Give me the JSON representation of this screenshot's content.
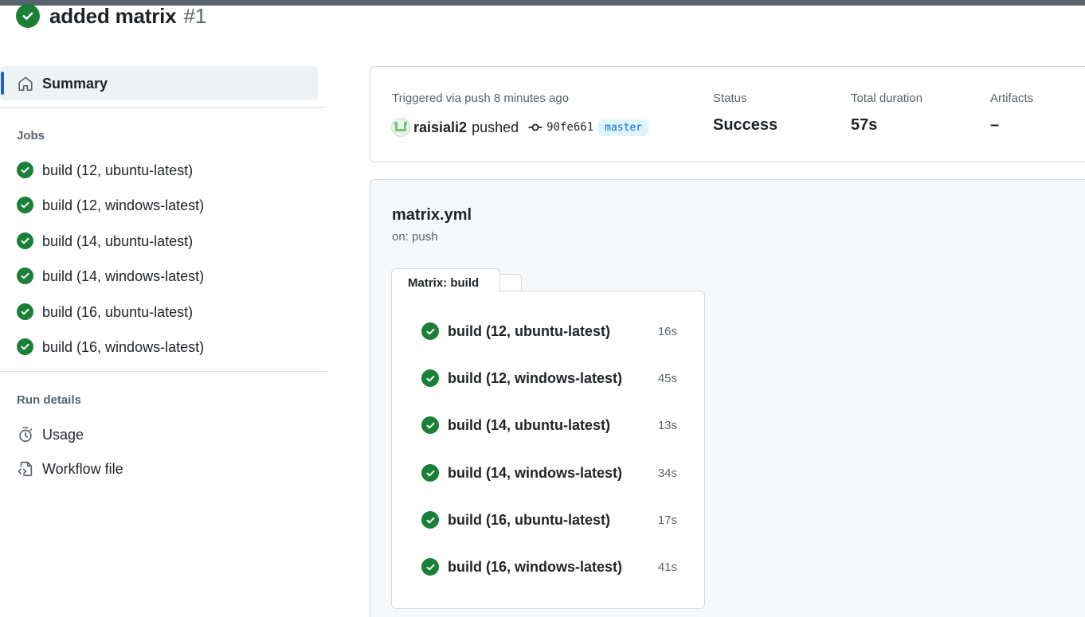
{
  "header": {
    "title": "added matrix",
    "run_number": "#1"
  },
  "sidebar": {
    "summary_label": "Summary",
    "jobs_heading": "Jobs",
    "jobs": [
      {
        "label": "build (12, ubuntu-latest)"
      },
      {
        "label": "build (12, windows-latest)"
      },
      {
        "label": "build (14, ubuntu-latest)"
      },
      {
        "label": "build (14, windows-latest)"
      },
      {
        "label": "build (16, ubuntu-latest)"
      },
      {
        "label": "build (16, windows-latest)"
      }
    ],
    "run_details_heading": "Run details",
    "details": [
      {
        "label": "Usage",
        "icon": "stopwatch-icon"
      },
      {
        "label": "Workflow file",
        "icon": "file-code-icon"
      }
    ]
  },
  "summary": {
    "triggered": "Triggered via push 8 minutes ago",
    "actor": "raisiali2",
    "action": "pushed",
    "commit": "90fe661",
    "branch": "master",
    "status_label": "Status",
    "status_value": "Success",
    "duration_label": "Total duration",
    "duration_value": "57s",
    "artifacts_label": "Artifacts",
    "artifacts_value": "–"
  },
  "workflow": {
    "name": "matrix.yml",
    "trigger": "on: push",
    "matrix_tab": "Matrix: build",
    "jobs": [
      {
        "label": "build (12, ubuntu-latest)",
        "duration": "16s"
      },
      {
        "label": "build (12, windows-latest)",
        "duration": "45s"
      },
      {
        "label": "build (14, ubuntu-latest)",
        "duration": "13s"
      },
      {
        "label": "build (14, windows-latest)",
        "duration": "34s"
      },
      {
        "label": "build (16, ubuntu-latest)",
        "duration": "17s"
      },
      {
        "label": "build (16, windows-latest)",
        "duration": "41s"
      }
    ]
  },
  "colors": {
    "success": "#1a7f37",
    "accent": "#0969da",
    "muted": "#59636e",
    "border": "#d1d9e0"
  }
}
